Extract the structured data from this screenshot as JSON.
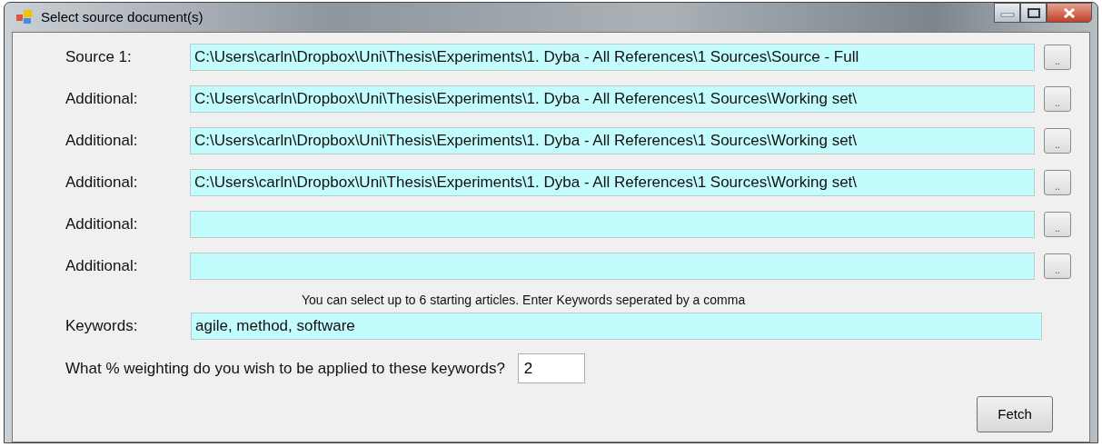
{
  "window": {
    "title": "Select source document(s)"
  },
  "sources": [
    {
      "label": "Source 1:",
      "value": "C:\\Users\\carln\\Dropbox\\Uni\\Thesis\\Experiments\\1. Dyba - All References\\1 Sources\\Source - Full",
      "browse": ".."
    },
    {
      "label": "Additional:",
      "value": "C:\\Users\\carln\\Dropbox\\Uni\\Thesis\\Experiments\\1. Dyba - All References\\1 Sources\\Working set\\",
      "browse": ".."
    },
    {
      "label": "Additional:",
      "value": "C:\\Users\\carln\\Dropbox\\Uni\\Thesis\\Experiments\\1. Dyba - All References\\1 Sources\\Working set\\",
      "browse": ".."
    },
    {
      "label": "Additional:",
      "value": "C:\\Users\\carln\\Dropbox\\Uni\\Thesis\\Experiments\\1. Dyba - All References\\1 Sources\\Working set\\",
      "browse": ".."
    },
    {
      "label": "Additional:",
      "browse": ".."
    },
    {
      "label": "Additional:",
      "browse": ".."
    }
  ],
  "hint": "You can select up to 6 starting articles. Enter Keywords seperated by a comma",
  "keywords": {
    "label": "Keywords:",
    "value": "agile, method, software"
  },
  "weighting": {
    "label": "What % weighting do you wish to be applied to these keywords?",
    "value": "2"
  },
  "fetch_button": "Fetch"
}
